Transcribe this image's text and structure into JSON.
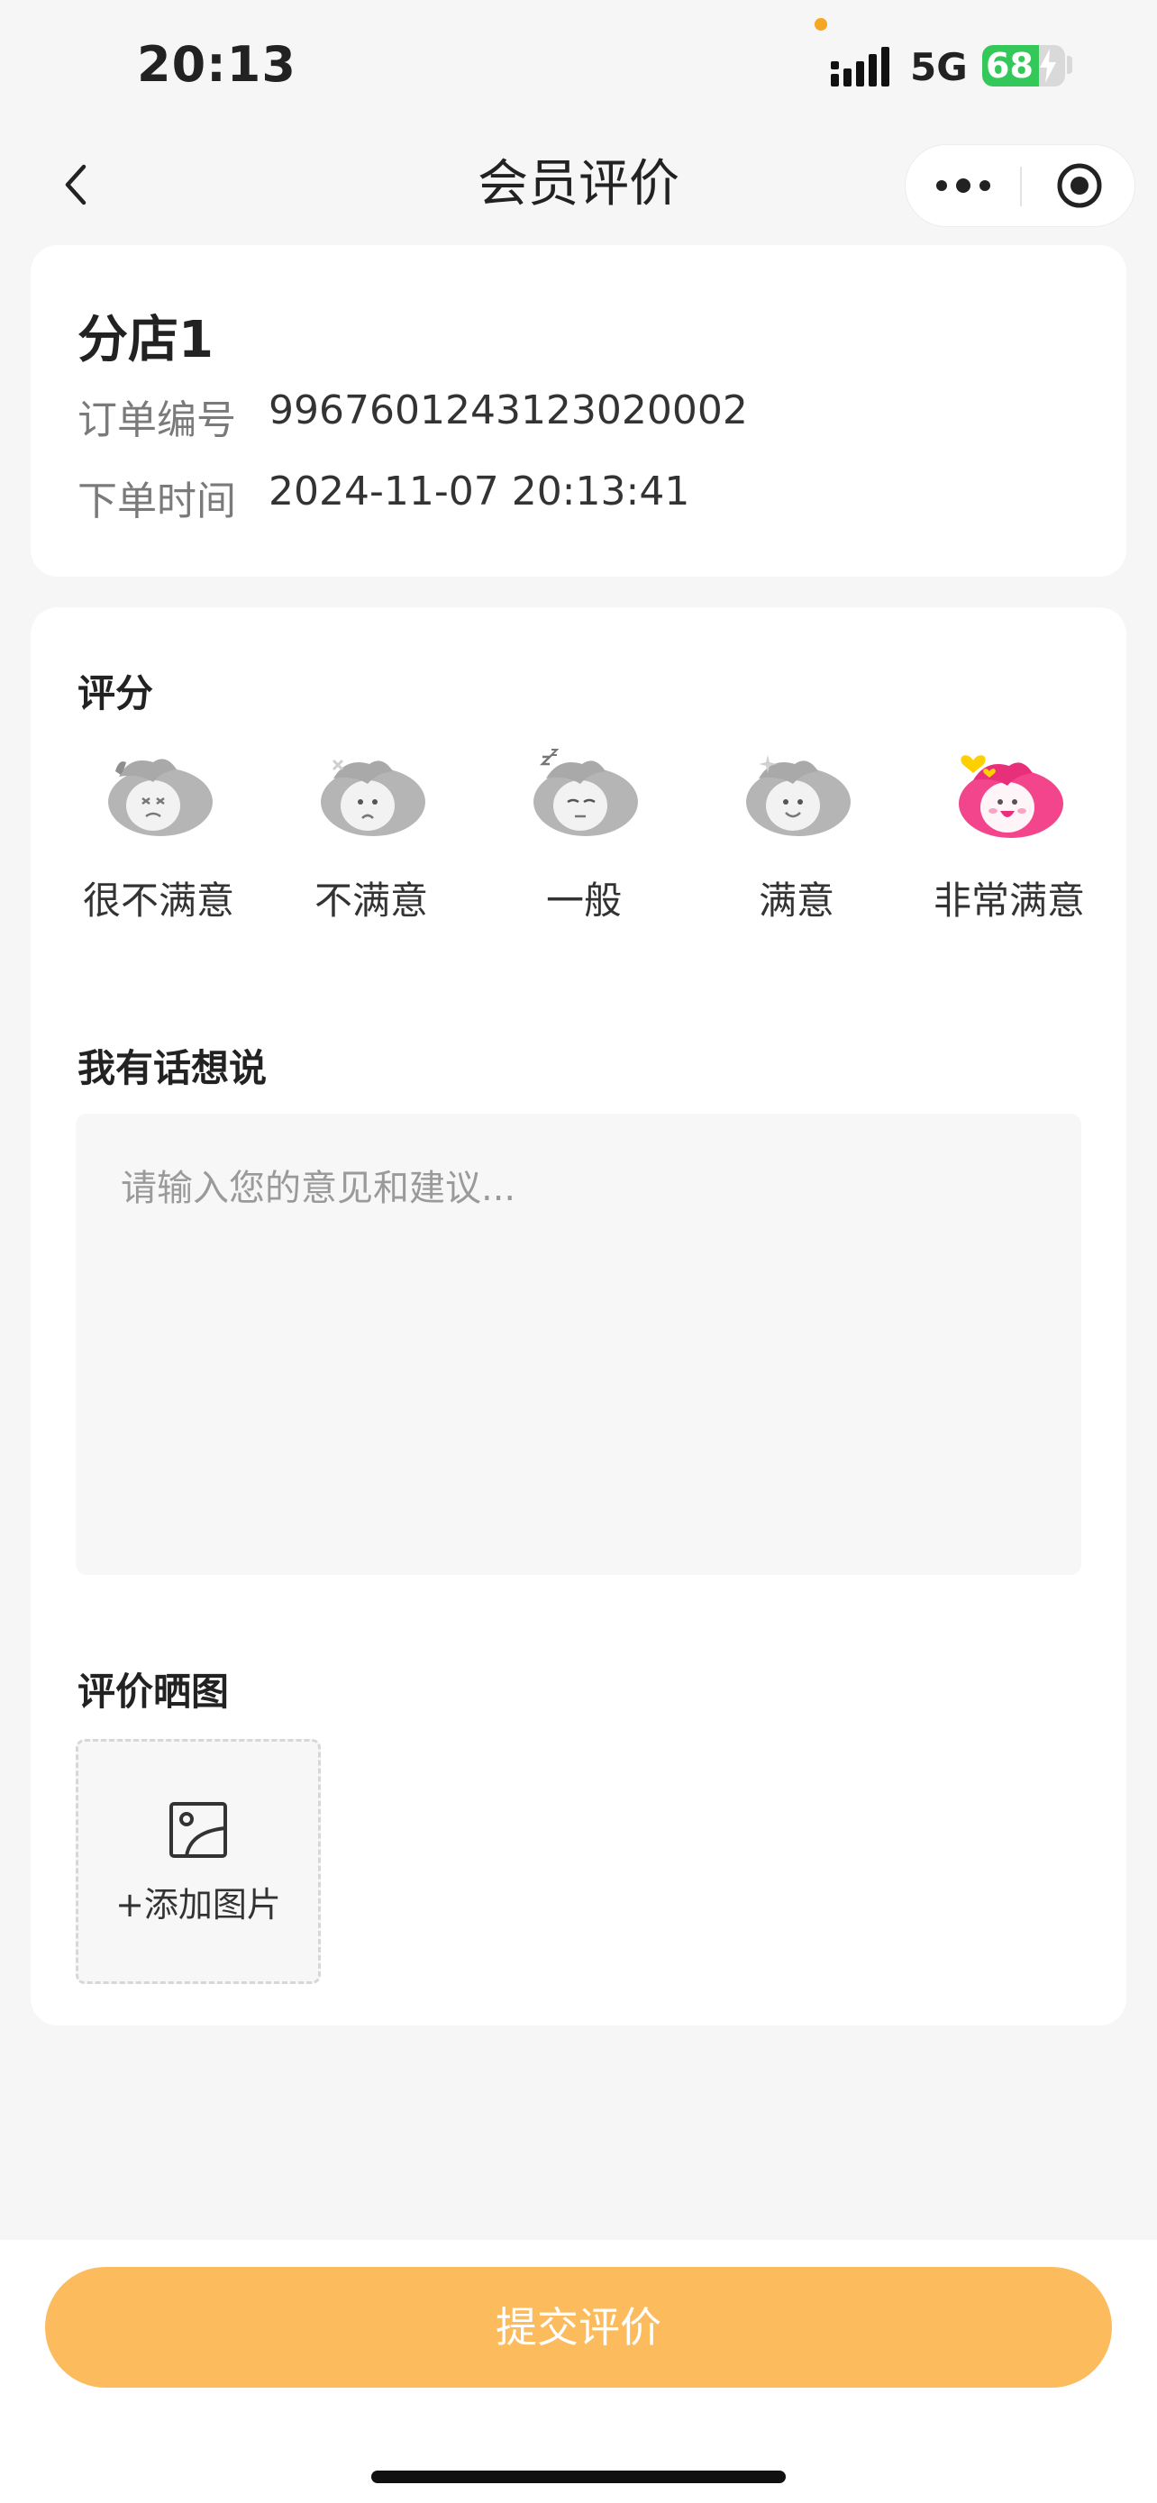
{
  "status_bar": {
    "time": "20:13",
    "network": "5G",
    "battery": "68",
    "battery_level": 0.68
  },
  "nav": {
    "title": "会员评价",
    "back_icon": "chevron-left-icon",
    "more_icon": "more-dots-icon",
    "close_icon": "target-circle-icon"
  },
  "order": {
    "store_name": "分店1",
    "order_no_label": "订单编号",
    "order_no": "996760124312302000​2",
    "order_time_label": "下单时间",
    "order_time": "2024-11-07 20:13:41"
  },
  "rating": {
    "title": "评分",
    "options": [
      {
        "label": "很不满意",
        "icon": "very-dissatisfied-face-icon",
        "selected": false
      },
      {
        "label": "不满意",
        "icon": "dissatisfied-face-icon",
        "selected": false
      },
      {
        "label": "一般",
        "icon": "neutral-sleepy-face-icon",
        "selected": false
      },
      {
        "label": "满意",
        "icon": "satisfied-face-icon",
        "selected": false
      },
      {
        "label": "非常满意",
        "icon": "very-satisfied-face-icon",
        "selected": true
      }
    ],
    "inactive_color": "#b5b5b5",
    "active_color": "#f2458b"
  },
  "comment": {
    "title": "我有话想说",
    "placeholder": "请输入您的意见和建议...",
    "value": ""
  },
  "photos": {
    "title": "评价晒图",
    "add_label": "+添加图片",
    "add_icon": "image-icon"
  },
  "submit": {
    "label": "提交评价",
    "color": "#fcbb5c"
  }
}
